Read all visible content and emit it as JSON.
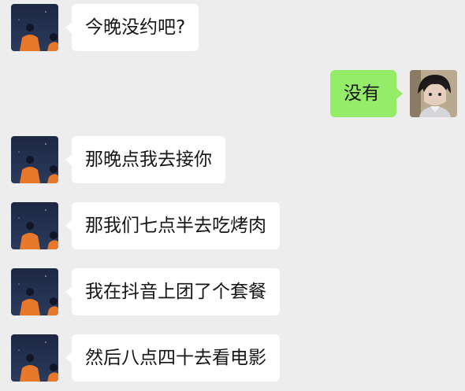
{
  "messages": [
    {
      "side": "in",
      "text": "今晚没约吧?"
    },
    {
      "side": "out",
      "text": "没有"
    },
    {
      "side": "in",
      "text": "那晚点我去接你"
    },
    {
      "side": "in",
      "text": "那我们七点半去吃烤肉"
    },
    {
      "side": "in",
      "text": "我在抖音上团了个套餐"
    },
    {
      "side": "in",
      "text": "然后八点四十去看电影"
    }
  ],
  "colors": {
    "background": "#ededed",
    "incoming_bubble": "#ffffff",
    "outgoing_bubble": "#95ec69",
    "text": "#151515"
  }
}
